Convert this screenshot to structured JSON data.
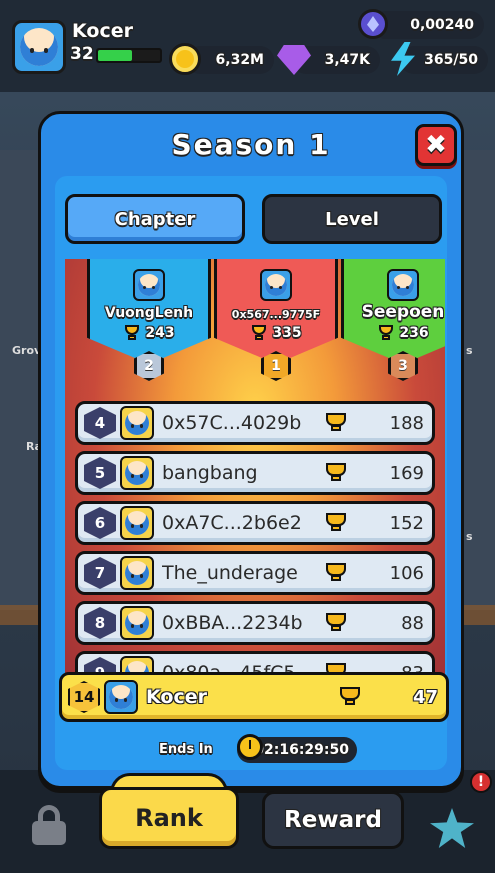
{
  "hud": {
    "player_name": "Kocer",
    "player_level": "32",
    "xp_fraction": 0.55,
    "eth_balance": "0,00240",
    "coins": "6,32M",
    "gems": "3,47K",
    "energy": "365/50"
  },
  "background": {
    "side_labels": [
      "Grov",
      "Ra",
      "s",
      "s"
    ]
  },
  "modal": {
    "title": "Season 1",
    "close_icon": "✖",
    "tabs": [
      {
        "label": "Chapter",
        "active": true
      },
      {
        "label": "Level",
        "active": false
      }
    ],
    "podium": [
      {
        "rank": "2",
        "name": "VuongLenh",
        "score": "243",
        "color": "#2aaeea",
        "badge_color": "#b9c7d9"
      },
      {
        "rank": "1",
        "name": "0x567...9775F",
        "score": "335",
        "color": "#ef5a56",
        "badge_color": "#f1a827"
      },
      {
        "rank": "3",
        "name": "Seepoen",
        "score": "236",
        "color": "#5ecf3e",
        "badge_color": "#d98a5a"
      }
    ],
    "leaderboard": [
      {
        "rank": "4",
        "name": "0x57C...4029b",
        "score": "188"
      },
      {
        "rank": "5",
        "name": "bangbang",
        "score": "169"
      },
      {
        "rank": "6",
        "name": "0xA7C...2b6e2",
        "score": "152"
      },
      {
        "rank": "7",
        "name": "The_underage",
        "score": "106"
      },
      {
        "rank": "8",
        "name": "0xBBA...2234b",
        "score": "88"
      },
      {
        "rank": "9",
        "name": "0x80a...45fC5",
        "score": "83"
      }
    ],
    "self_row": {
      "rank": "14",
      "name": "Kocer",
      "score": "47"
    },
    "ends_in_label": "Ends In",
    "ends_in_value": "02:16:29:50"
  },
  "bottom": {
    "rank_button": "Rank",
    "reward_button": "Reward",
    "alert_badge": "!"
  },
  "colors": {
    "modal_blue": "#2a8be8",
    "accent_yellow": "#fbd94a",
    "close_red": "#e23434"
  }
}
